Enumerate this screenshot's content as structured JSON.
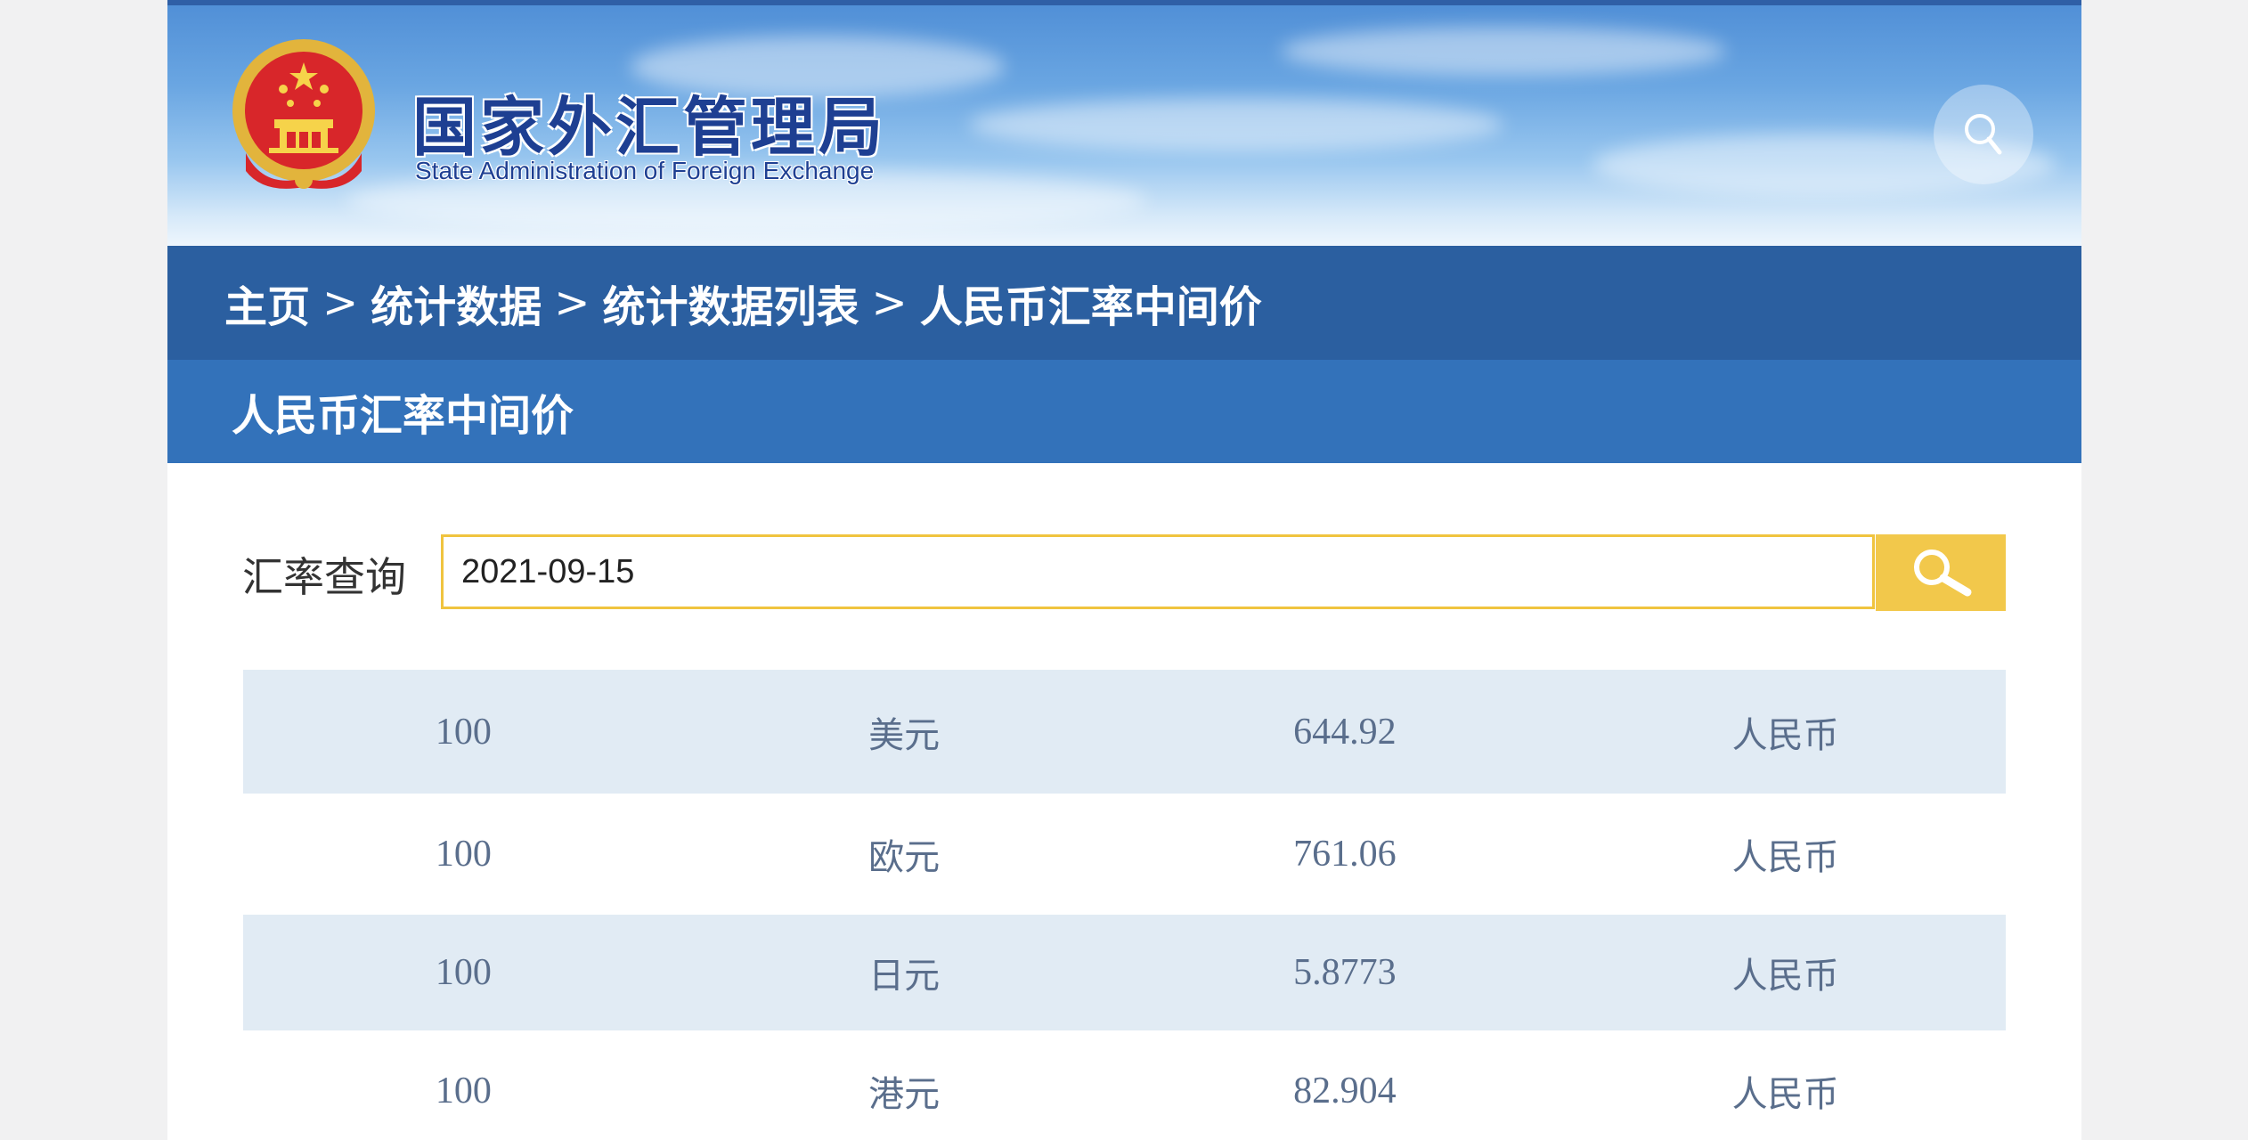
{
  "header": {
    "title_cn": "国家外汇管理局",
    "title_en": "State Administration of Foreign Exchange",
    "emblem_icon": "national-emblem-icon",
    "search_icon": "search-icon"
  },
  "breadcrumb": {
    "items": [
      "主页",
      "统计数据",
      "统计数据列表",
      "人民币汇率中间价"
    ],
    "separator": ">"
  },
  "section": {
    "title": "人民币汇率中间价"
  },
  "query": {
    "label": "汇率查询",
    "value": "2021-09-15",
    "button_icon": "search-icon"
  },
  "rates": [
    {
      "amount": "100",
      "currency": "美元",
      "rate": "644.92",
      "target": "人民币"
    },
    {
      "amount": "100",
      "currency": "欧元",
      "rate": "761.06",
      "target": "人民币"
    },
    {
      "amount": "100",
      "currency": "日元",
      "rate": "5.8773",
      "target": "人民币"
    },
    {
      "amount": "100",
      "currency": "港元",
      "rate": "82.904",
      "target": "人民币"
    }
  ],
  "colors": {
    "breadcrumb_bg": "#2b5fa0",
    "section_bg": "#3372ba",
    "accent_yellow": "#f2c84b",
    "row_shade": "#e1ebf4",
    "title_blue": "#1e3f92"
  }
}
